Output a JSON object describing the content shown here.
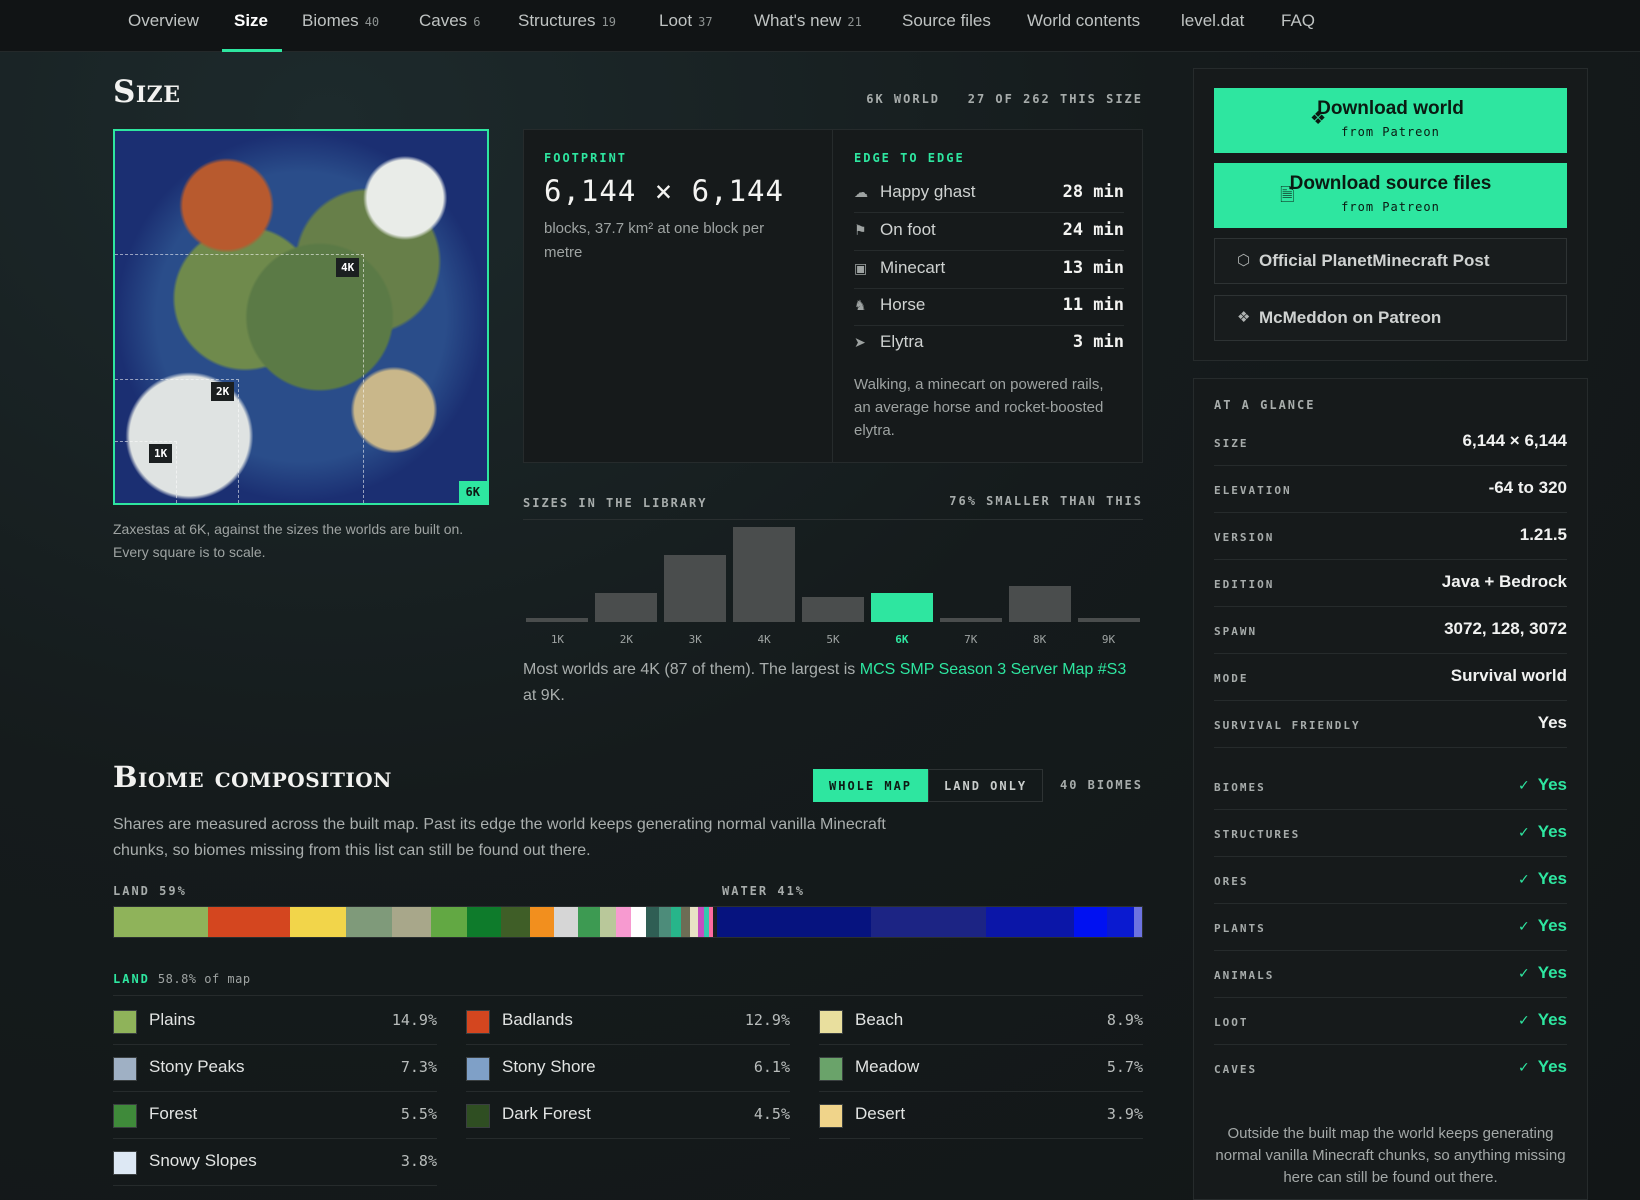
{
  "nav": {
    "tabs": [
      {
        "label": "Overview",
        "count": ""
      },
      {
        "label": "Size",
        "count": ""
      },
      {
        "label": "Biomes",
        "count": "40"
      },
      {
        "label": "Caves",
        "count": "6"
      },
      {
        "label": "Structures",
        "count": "19"
      },
      {
        "label": "Loot",
        "count": "37"
      },
      {
        "label": "What's new",
        "count": "21"
      },
      {
        "label": "Source files",
        "count": ""
      },
      {
        "label": "World contents",
        "count": ""
      },
      {
        "label": "level.dat",
        "count": ""
      },
      {
        "label": "FAQ",
        "count": ""
      }
    ],
    "active": "Size"
  },
  "size_section": {
    "title": "Size",
    "world_tag": "6K WORLD",
    "rank_tag": "27 OF 262 THIS SIZE",
    "map_tags": [
      "4K",
      "2K",
      "1K",
      "6K"
    ],
    "map_caption": "Zaxestas at 6K, against the sizes the worlds are built on. Every square is to scale."
  },
  "footprint": {
    "label": "FOOTPRINT",
    "value": "6,144 × 6,144",
    "desc": "blocks, 37.7 km² at one block per metre"
  },
  "edge_to_edge": {
    "label": "EDGE TO EDGE",
    "rows": [
      {
        "name": "Happy ghast",
        "value": "28 min",
        "icon": "ghast-icon"
      },
      {
        "name": "On foot",
        "value": "24 min",
        "icon": "walking-icon"
      },
      {
        "name": "Minecart",
        "value": "13 min",
        "icon": "minecart-icon"
      },
      {
        "name": "Horse",
        "value": "11 min",
        "icon": "horse-icon"
      },
      {
        "name": "Elytra",
        "value": "3 min",
        "icon": "elytra-icon"
      }
    ],
    "note": "Walking, a minecart on powered rails, an average horse and rocket-boosted elytra."
  },
  "library": {
    "label": "SIZES IN THE LIBRARY",
    "right_label": "76% SMALLER THAN THIS",
    "note_prefix": "Most worlds are 4K (87 of them). The largest is ",
    "note_link": "MCS SMP Season 3 Server Map #S3",
    "note_suffix": " at 9K."
  },
  "chart_data": {
    "type": "bar",
    "categories": [
      "1K",
      "2K",
      "3K",
      "4K",
      "5K",
      "6K",
      "7K",
      "8K",
      "9K"
    ],
    "values": [
      4,
      27,
      61,
      87,
      23,
      27,
      4,
      33,
      4
    ],
    "highlight": "6K",
    "ylim": [
      0,
      87
    ]
  },
  "biome_section": {
    "title": "Biome composition",
    "btn_whole": "WHOLE MAP",
    "btn_land": "LAND ONLY",
    "count": "40 BIOMES",
    "desc": "Shares are measured across the built map. Past its edge the world keeps generating normal vanilla Minecraft chunks, so biomes missing from this list can still be found out there.",
    "land_label": "LAND 59%",
    "water_label": "WATER 41%",
    "strip": [
      {
        "c": "#8fb35a",
        "w": 14.9
      },
      {
        "c": "#d4461f",
        "w": 12.9
      },
      {
        "c": "#f2d54a",
        "w": 8.9
      },
      {
        "c": "#7f9a7a",
        "w": 7.3
      },
      {
        "c": "#a8a78a",
        "w": 6.1
      },
      {
        "c": "#62a843",
        "w": 5.7
      },
      {
        "c": "#0e7b2b",
        "w": 5.5
      },
      {
        "c": "#3f5e27",
        "w": 4.5
      },
      {
        "c": "#f28f1e",
        "w": 3.9
      },
      {
        "c": "#d6d6d6",
        "w": 3.8
      },
      {
        "c": "#3d9a52",
        "w": 3.4
      },
      {
        "c": "#b9c89a",
        "w": 2.6
      },
      {
        "c": "#f79ad0",
        "w": 2.4
      },
      {
        "c": "#ffffff",
        "w": 2.3
      },
      {
        "c": "#2f5e54",
        "w": 2.1
      },
      {
        "c": "#4d8c7a",
        "w": 1.9
      },
      {
        "c": "#27b58a",
        "w": 1.6
      },
      {
        "c": "#6d6d55",
        "w": 1.4
      },
      {
        "c": "#e8e1c5",
        "w": 1.2
      },
      {
        "c": "#c44ec0",
        "w": 1.0
      },
      {
        "c": "#33c9ad",
        "w": 0.8
      },
      {
        "c": "#ff6aa0",
        "w": 0.6
      },
      {
        "c": "#1a1f20",
        "w": 0.6
      },
      {
        "c": "#06137f",
        "w": 24.4
      },
      {
        "c": "#1c2484",
        "w": 18.3
      },
      {
        "c": "#0b16a8",
        "w": 13.8
      },
      {
        "c": "#0011f2",
        "w": 5.3
      },
      {
        "c": "#0a1ad0",
        "w": 4.3
      },
      {
        "c": "#6d73e0",
        "w": 1.2
      }
    ],
    "land_head": "LAND",
    "land_sub": "58.8% of map",
    "biomes": [
      {
        "name": "Plains",
        "pct": "14.9%",
        "c": "#8fb35a"
      },
      {
        "name": "Badlands",
        "pct": "12.9%",
        "c": "#d4461f"
      },
      {
        "name": "Beach",
        "pct": "8.9%",
        "c": "#e9df9e"
      },
      {
        "name": "Stony Peaks",
        "pct": "7.3%",
        "c": "#9fb0c4"
      },
      {
        "name": "Stony Shore",
        "pct": "6.1%",
        "c": "#7fa0c7"
      },
      {
        "name": "Meadow",
        "pct": "5.7%",
        "c": "#6aa36a"
      },
      {
        "name": "Forest",
        "pct": "5.5%",
        "c": "#3f8a3a"
      },
      {
        "name": "Dark Forest",
        "pct": "4.5%",
        "c": "#2f4e22"
      },
      {
        "name": "Desert",
        "pct": "3.9%",
        "c": "#f0d48a"
      },
      {
        "name": "Snowy Slopes",
        "pct": "3.8%",
        "c": "#dde8f4"
      }
    ]
  },
  "sidebar": {
    "download_world": "Download world",
    "download_world_sub": "from Patreon",
    "download_source": "Download source files",
    "download_source_sub": "from Patreon",
    "official_post": "Official PlanetMinecraft Post",
    "patreon": "McMeddon on Patreon",
    "glance_title": "AT A GLANCE",
    "glance": [
      {
        "k": "SIZE",
        "v": "6,144 × 6,144"
      },
      {
        "k": "ELEVATION",
        "v": "-64 to 320"
      },
      {
        "k": "VERSION",
        "v": "1.21.5"
      },
      {
        "k": "EDITION",
        "v": "Java + Bedrock"
      },
      {
        "k": "SPAWN",
        "v": "3072, 128, 3072"
      },
      {
        "k": "MODE",
        "v": "Survival world"
      },
      {
        "k": "SURVIVAL FRIENDLY",
        "v": "Yes"
      }
    ],
    "checks": [
      {
        "k": "BIOMES",
        "v": "Yes"
      },
      {
        "k": "STRUCTURES",
        "v": "Yes"
      },
      {
        "k": "ORES",
        "v": "Yes"
      },
      {
        "k": "PLANTS",
        "v": "Yes"
      },
      {
        "k": "ANIMALS",
        "v": "Yes"
      },
      {
        "k": "LOOT",
        "v": "Yes"
      },
      {
        "k": "CAVES",
        "v": "Yes"
      }
    ],
    "glance_note": "Outside the built map the world keeps generating normal vanilla Minecraft chunks, so anything missing here can still be found out there."
  }
}
